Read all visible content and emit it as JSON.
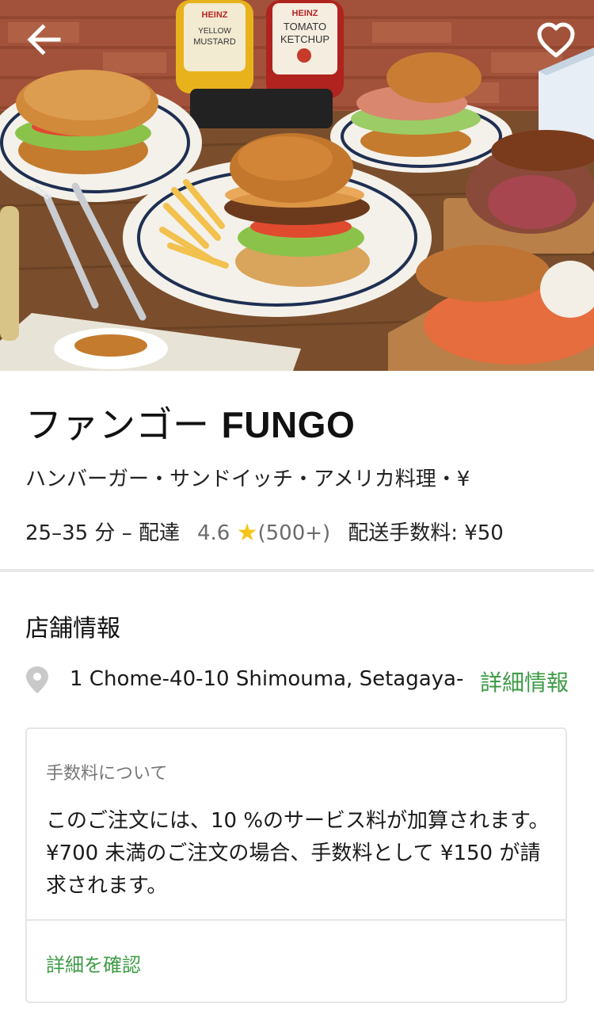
{
  "header": {
    "back_icon": "arrow-left-icon",
    "favorite_icon": "heart-outline-icon",
    "hero_image": "burger-spread-photo",
    "bottle_left": {
      "brand": "HEINZ",
      "line1": "YELLOW",
      "line2": "MUSTARD"
    },
    "bottle_right": {
      "brand": "HEINZ",
      "line1": "TOMATO",
      "line2": "KETCHUP"
    }
  },
  "store": {
    "name_jp": "ファンゴー",
    "name_en": "FUNGO",
    "categories": "ハンバーガー・サンドイッチ・アメリカ料理・¥",
    "delivery_time": "25–35 分 – 配達",
    "rating": "4.6",
    "rating_icon": "star-icon",
    "rating_count": "(500+)",
    "delivery_fee": "配送手数料: ¥50"
  },
  "info": {
    "section_title": "店舗情報",
    "address_icon": "location-pin-icon",
    "address": "1 Chome-40-10 Shimouma, Setagaya-",
    "detail_link": "詳細情報"
  },
  "fees": {
    "title": "手数料について",
    "description": "このご注文には、10 %のサービス料が加算されます。¥700 未満のご注文の場合、手数料として ¥150 が請求されます。",
    "link": "詳細を確認"
  },
  "colors": {
    "accent_green": "#3e9b46",
    "rating_star": "#f5c518",
    "muted_text": "#6b6b6b"
  }
}
